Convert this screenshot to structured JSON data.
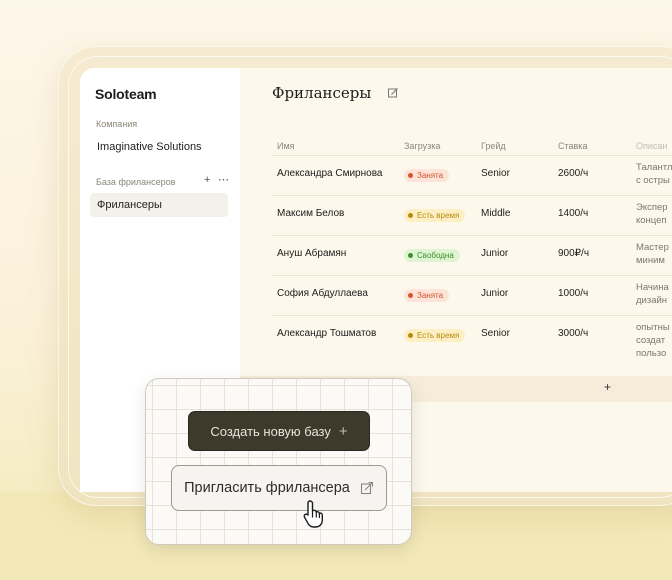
{
  "app": {
    "brand": "Soloteam",
    "company_label": "Компания",
    "company_name": "Imaginative Solutions",
    "bases_label": "База фрилансеров",
    "nav_item": "Фрилансеры"
  },
  "page": {
    "title": "Фрилансеры"
  },
  "table": {
    "headers": [
      "Имя",
      "Загрузка",
      "Грейд",
      "Ставка",
      "Описан"
    ],
    "rows": [
      {
        "name": "Александра Смирнова",
        "status": "Занята",
        "status_color": "#d2572f",
        "grade": "Senior",
        "rate": "2600/ч",
        "desc1": "Талантл",
        "desc2": "с остры"
      },
      {
        "name": "Максим Белов",
        "status": "Есть время",
        "status_color": "#b98a12",
        "grade": "Middle",
        "rate": "1400/ч",
        "desc1": "Экспер",
        "desc2": "концеп"
      },
      {
        "name": "Ануш Абрамян",
        "status": "Свободна",
        "status_color": "#3f8f2a",
        "grade": "Junior",
        "rate": "900₽/ч",
        "desc1": "Мастер",
        "desc2": "миним"
      },
      {
        "name": "София Абдуллаева",
        "status": "Занята",
        "status_color": "#d2572f",
        "grade": "Junior",
        "rate": "1000/ч",
        "desc1": "Начина",
        "desc2": "дизайн"
      },
      {
        "name": "Александр Тошматов",
        "status": "Есть время",
        "status_color": "#b98a12",
        "grade": "Senior",
        "rate": "3000/ч",
        "desc1": "опытны",
        "desc2": "создат",
        "desc3": "пользо"
      }
    ]
  },
  "popup": {
    "create_label": "Создать новую базу",
    "invite_label": "Пригласить фрилансера"
  },
  "colors": {
    "accent_dark": "#3d3a2c",
    "background": "#fdf8ec"
  }
}
